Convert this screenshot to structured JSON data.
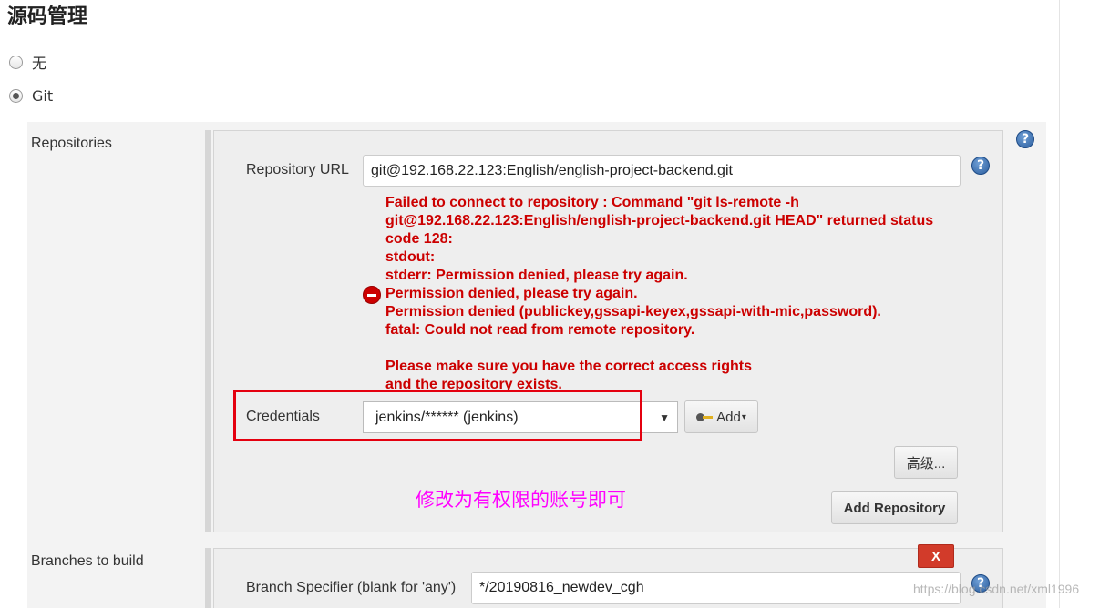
{
  "section": {
    "title": "源码管理"
  },
  "scm_options": [
    {
      "label": "无",
      "selected": false
    },
    {
      "label": "Git",
      "selected": true
    }
  ],
  "repositories": {
    "label": "Repositories",
    "repository_url_label": "Repository URL",
    "repository_url_value": "git@192.168.22.123:English/english-project-backend.git",
    "error_message": "Failed to connect to repository : Command \"git ls-remote -h\ngit@192.168.22.123:English/english-project-backend.git HEAD\" returned status\ncode 128:\nstdout:\nstderr: Permission denied, please try again.\nPermission denied, please try again.\nPermission denied (publickey,gssapi-keyex,gssapi-with-mic,password).\nfatal: Could not read from remote repository.\n\nPlease make sure you have the correct access rights\nand the repository exists.",
    "credentials_label": "Credentials",
    "credentials_selected": "jenkins/****** (jenkins)",
    "add_button_label": "Add",
    "advanced_button_label": "高级...",
    "add_repository_button_label": "Add Repository"
  },
  "annotation_text": "修改为有权限的账号即可",
  "branches": {
    "label": "Branches to build",
    "delete_button_label": "X",
    "branch_specifier_label": "Branch Specifier (blank for 'any')",
    "branch_specifier_value": "*/20190816_newdev_cgh"
  },
  "help_icon_glyph": "?",
  "watermark": "https://blog.csdn.net/xml1996",
  "colors": {
    "error_red": "#cc0000",
    "annotation_magenta": "#ff00ff",
    "highlight_box_red": "#e4000f",
    "delete_button_red": "#d23b2a",
    "help_icon_blue": "#2c5e9e"
  }
}
